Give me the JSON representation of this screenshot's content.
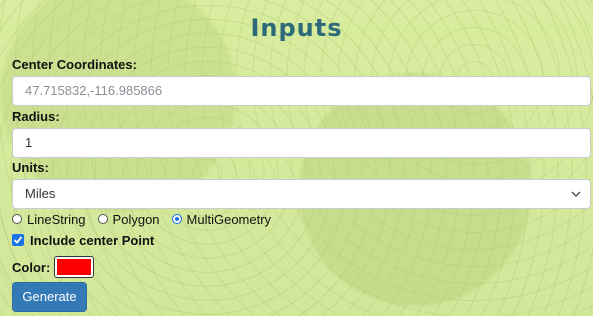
{
  "form": {
    "title": "Inputs",
    "center": {
      "label": "Center Coordinates:",
      "placeholder": "47.715832,-116.985866"
    },
    "radius": {
      "label": "Radius:",
      "value": "1"
    },
    "units": {
      "label": "Units:",
      "selected": "Miles"
    },
    "geometry": {
      "options": [
        "LineString",
        "Polygon",
        "MultiGeometry"
      ],
      "selected": "MultiGeometry"
    },
    "include_center": {
      "label": "Include center Point",
      "checked": true
    },
    "color": {
      "label": "Color:",
      "value": "#ff0000"
    },
    "generate_label": "Generate"
  },
  "theme": {
    "title_color": "#2f6a7a",
    "button_color": "#337ab7",
    "accent": "#1a73e8"
  }
}
